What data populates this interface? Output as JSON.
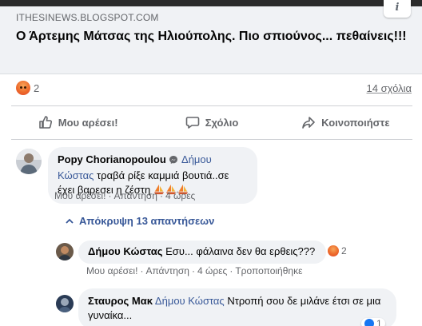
{
  "link_preview": {
    "domain": "ITHESINEWS.BLOGSPOT.COM",
    "title": "Ο Άρτεμης Μάτσας της Ηλιούπολης. Πιο σπιούνος... πεθαίνεις!!!",
    "info_icon": "info-icon"
  },
  "reactions": {
    "icon": "angry-reaction-icon",
    "count": "2",
    "comments_link": "14 σχόλια"
  },
  "actions": [
    {
      "label": "Μου αρέσει!",
      "icon": "like-icon"
    },
    {
      "label": "Σχόλιο",
      "icon": "comment-icon"
    },
    {
      "label": "Κοινοποιήστε",
      "icon": "share-icon"
    }
  ],
  "comments": {
    "first": {
      "author": "Popy Chorianopoulou",
      "author_icon": "messenger-icon",
      "mention": "Δήμου Κώστας",
      "text": "τραβά ρίξε καμμιά βουτιά..σε έχει βαρεσει η ζέστη",
      "emoji": "sailboat-icon",
      "emoji_count": 3,
      "like": "Μου αρέσει!",
      "reply": "Απάντηση",
      "time": "4 ώρες"
    },
    "toggle_replies": "Απόκρυψη 13 απαντήσεων",
    "replies": [
      {
        "author": "Δήμου Κώστας",
        "text": "Εσυ... φάλαινα δεν θα ερθεις???",
        "reaction_icon": "angry-reaction-icon",
        "reaction_count": "2",
        "like": "Μου αρέσει!",
        "reply": "Απάντηση",
        "time": "4 ώρες",
        "edited": "Τροποποιήθηκε"
      },
      {
        "author": "Σταυρος Μακ",
        "mention": "Δήμου Κώστας",
        "text": "Ντροπή σου δε μιλάνε έτσι σε μια γυναίκα...",
        "reaction_icon": "like-reaction-icon",
        "reaction_count": "1"
      }
    ]
  },
  "colors": {
    "link": "#385898",
    "secondary_text": "#65676b",
    "bubble": "#f0f2f5",
    "like_blue": "#1877f2"
  }
}
